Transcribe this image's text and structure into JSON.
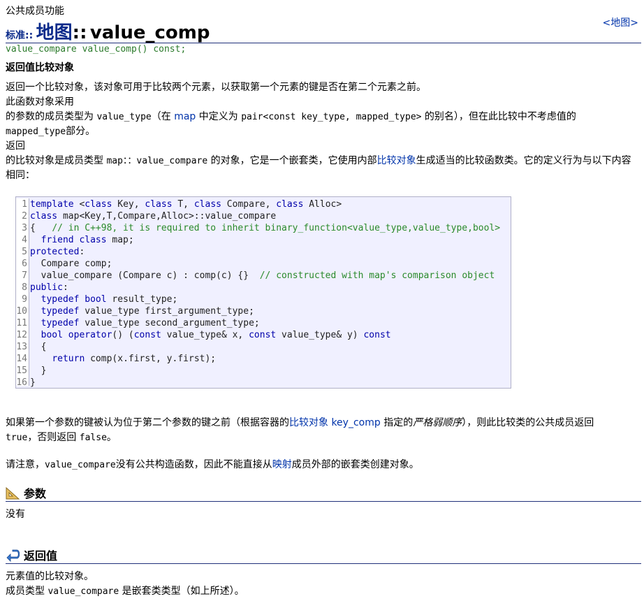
{
  "breadcrumb": "公共成员功能",
  "map_link": "<地图>",
  "title": {
    "namespace": "标准::",
    "class": "地图",
    "sep": "::",
    "member": "value_comp"
  },
  "prototype": "value_compare value_comp() const;",
  "summary_heading": "返回值比较对象",
  "para1": "返回一个比较对象，该对象可用于比较两个元素，以获取第一个元素的键是否在第二个元素之前。",
  "para2_line1": "此函数对象采用",
  "para2_line2_a": "的参数的成员类型为 ",
  "para2_value_type": "value_type",
  "para2_line2_b": "（在 ",
  "para2_map": "map",
  "para2_line2_c": " 中定义为 ",
  "para2_pair": "pair<const key_type, mapped_type>",
  "para2_line2_d": " 的别名），但在此比较中不考虑值的",
  "para2_mapped": "mapped_type",
  "para2_line3_b": "部分。",
  "para3_line1": "返回",
  "para3_a": "的比较对象是成员类型 ",
  "para3_code": "map：：value_compare",
  "para3_b": " 的对象，它是一个嵌套类，它使用内部",
  "para3_link": "比较对象",
  "para3_c": "生成适当的比较函数类。它的定义行为与以下内容相同：",
  "code_lines": [
    {
      "n": "1",
      "html": "<span class='kw'>template</span> &lt;<span class='kw'>class</span> Key, <span class='kw'>class</span> T, <span class='kw'>class</span> Compare, <span class='kw'>class</span> Alloc&gt;"
    },
    {
      "n": "2",
      "html": "<span class='kw'>class</span> map&lt;Key,T,Compare,Alloc&gt;::value_compare"
    },
    {
      "n": "3",
      "html": "{   <span class='cm'>// in C++98, it is required to inherit binary_function&lt;value_type,value_type,bool&gt;</span>"
    },
    {
      "n": "4",
      "html": "  <span class='kw'>friend class</span> map;"
    },
    {
      "n": "5",
      "html": "<span class='kw'>protected</span>:"
    },
    {
      "n": "6",
      "html": "  Compare comp;"
    },
    {
      "n": "7",
      "html": "  value_compare (Compare c) : comp(c) {}  <span class='cm'>// constructed with map's comparison object</span>"
    },
    {
      "n": "8",
      "html": "<span class='kw'>public</span>:"
    },
    {
      "n": "9",
      "html": "  <span class='kw'>typedef bool</span> result_type;"
    },
    {
      "n": "10",
      "html": "  <span class='kw'>typedef</span> value_type first_argument_type;"
    },
    {
      "n": "11",
      "html": "  <span class='kw'>typedef</span> value_type second_argument_type;"
    },
    {
      "n": "12",
      "html": "  <span class='kw'>bool operator</span>() (<span class='kw'>const</span> value_type&amp; x, <span class='kw'>const</span> value_type&amp; y) <span class='kw'>const</span>"
    },
    {
      "n": "13",
      "html": "  {"
    },
    {
      "n": "14",
      "html": "    <span class='kw'>return</span> comp(x.first, y.first);"
    },
    {
      "n": "15",
      "html": "  }"
    },
    {
      "n": "16",
      "html": "}"
    }
  ],
  "para4_a": "如果第一个参数的键被认为位于第二个参数的键之前（根据容器的",
  "para4_link1": "比较对象",
  "para4_link2": "key_comp",
  "para4_b": " 指定的",
  "para4_italic": "严格弱顺序",
  "para4_c": "），则此比较类的公共成员返回",
  "para4_true": "true",
  "para4_d": "，否则返回 ",
  "para4_false": "false",
  "para4_e": "。",
  "para5_a": "请注意，",
  "para5_code": "value_compare",
  "para5_b": "没有公共构造函数，因此不能直接从",
  "para5_link": "映射",
  "para5_c": "成员外部的嵌套类创建对象。",
  "params_heading": "参数",
  "params_text": "没有",
  "return_heading": "返回值",
  "return_line1": "元素值的比较对象。",
  "return_line2_a": "成员类型 ",
  "return_line2_code": "value_compare",
  "return_line2_b": " 是嵌套类类型（如上所述）。"
}
